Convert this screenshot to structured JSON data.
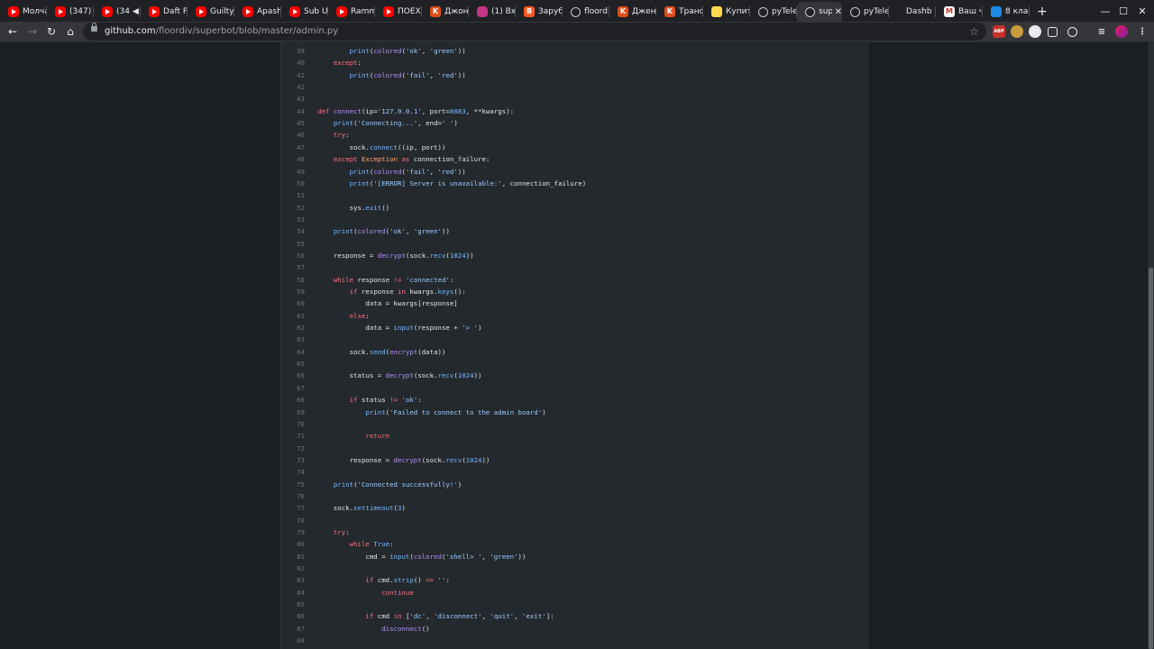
{
  "browser": {
    "tabs": [
      {
        "label": "Молча",
        "icon": "youtube-icon"
      },
      {
        "label": "(347) Y",
        "icon": "youtube-icon"
      },
      {
        "label": "(34 ◀",
        "icon": "youtube-icon"
      },
      {
        "label": "Daft P",
        "icon": "youtube-icon"
      },
      {
        "label": "Guilty",
        "icon": "youtube-icon"
      },
      {
        "label": "Apash",
        "icon": "youtube-icon"
      },
      {
        "label": "Sub U",
        "icon": "youtube-icon"
      },
      {
        "label": "Ramm",
        "icon": "youtube-icon"
      },
      {
        "label": "ПОЕХ",
        "icon": "youtube-icon"
      },
      {
        "label": "Джон",
        "icon": "kinopoisk-icon"
      },
      {
        "label": "(1) Вх",
        "icon": "instagram-icon"
      },
      {
        "label": "Заруб",
        "icon": "blogger-icon"
      },
      {
        "label": "floord",
        "icon": "github-icon"
      },
      {
        "label": "Джен",
        "icon": "kinopoisk-icon"
      },
      {
        "label": "Транс",
        "icon": "kinopoisk-icon"
      },
      {
        "label": "Купит",
        "icon": "yandex-market-icon"
      },
      {
        "label": "pyTele",
        "icon": "github-icon"
      },
      {
        "label": "sup",
        "icon": "github-icon",
        "active": true
      },
      {
        "label": "pyTele",
        "icon": "github-icon"
      },
      {
        "label": "Dashb",
        "icon": "blank-icon"
      },
      {
        "label": "Ваш ч",
        "icon": "gmail-icon"
      },
      {
        "label": "8 клас",
        "icon": "school-icon"
      }
    ],
    "url_host": "github.com",
    "url_path": "/floordiv/superbot/blob/master/admin.py",
    "new_tab": "+",
    "close_tab": "✕",
    "window_minimize": "—",
    "window_maximize": "☐",
    "window_close": "✕",
    "ext_abp": "ABP"
  },
  "code": {
    "lines": [
      {
        "n": "39",
        "t": [
          [
            "        ",
            ""
          ],
          [
            "print",
            "bi"
          ],
          [
            "(",
            ""
          ],
          [
            "colored",
            "fn"
          ],
          [
            "(",
            ""
          ],
          [
            "'ok'",
            "st"
          ],
          [
            ", ",
            ""
          ],
          [
            "'green'",
            "st"
          ],
          [
            "))",
            ""
          ]
        ]
      },
      {
        "n": "40",
        "t": [
          [
            "    ",
            ""
          ],
          [
            "except",
            "kw"
          ],
          [
            ":",
            ""
          ]
        ]
      },
      {
        "n": "41",
        "t": [
          [
            "        ",
            ""
          ],
          [
            "print",
            "bi"
          ],
          [
            "(",
            ""
          ],
          [
            "colored",
            "fn"
          ],
          [
            "(",
            ""
          ],
          [
            "'fail'",
            "st"
          ],
          [
            ", ",
            ""
          ],
          [
            "'red'",
            "st"
          ],
          [
            "))",
            ""
          ]
        ]
      },
      {
        "n": "42",
        "t": []
      },
      {
        "n": "43",
        "t": []
      },
      {
        "n": "44",
        "t": [
          [
            "def ",
            "kw"
          ],
          [
            "connect",
            "fn"
          ],
          [
            "(ip=",
            ""
          ],
          [
            "'127.0.0.1'",
            "st"
          ],
          [
            ", port=",
            ""
          ],
          [
            "8083",
            "nu"
          ],
          [
            ", **kwargs):",
            ""
          ]
        ]
      },
      {
        "n": "45",
        "t": [
          [
            "    ",
            ""
          ],
          [
            "print",
            "bi"
          ],
          [
            "(",
            ""
          ],
          [
            "'Connecting...'",
            "st"
          ],
          [
            ", end=",
            ""
          ],
          [
            "' '",
            "st"
          ],
          [
            ")",
            ""
          ]
        ]
      },
      {
        "n": "46",
        "t": [
          [
            "    ",
            ""
          ],
          [
            "try",
            "kw"
          ],
          [
            ":",
            ""
          ]
        ]
      },
      {
        "n": "47",
        "t": [
          [
            "        sock.",
            ""
          ],
          [
            "connect",
            "bi"
          ],
          [
            "((ip, port))",
            ""
          ]
        ]
      },
      {
        "n": "48",
        "t": [
          [
            "    ",
            ""
          ],
          [
            "except ",
            "kw"
          ],
          [
            "Exception",
            "ex"
          ],
          [
            " as ",
            "kw"
          ],
          [
            "connection_failure:",
            ""
          ]
        ]
      },
      {
        "n": "49",
        "t": [
          [
            "        ",
            ""
          ],
          [
            "print",
            "bi"
          ],
          [
            "(",
            ""
          ],
          [
            "colored",
            "fn"
          ],
          [
            "(",
            ""
          ],
          [
            "'fail'",
            "st"
          ],
          [
            ", ",
            ""
          ],
          [
            "'red'",
            "st"
          ],
          [
            "))",
            ""
          ]
        ]
      },
      {
        "n": "50",
        "t": [
          [
            "        ",
            ""
          ],
          [
            "print",
            "bi"
          ],
          [
            "(",
            ""
          ],
          [
            "'[ERROR] Server is unavailable:'",
            "st"
          ],
          [
            ", connection_failure)",
            ""
          ]
        ]
      },
      {
        "n": "51",
        "t": []
      },
      {
        "n": "52",
        "t": [
          [
            "        sys.",
            ""
          ],
          [
            "exit",
            "bi"
          ],
          [
            "()",
            ""
          ]
        ]
      },
      {
        "n": "53",
        "t": []
      },
      {
        "n": "54",
        "t": [
          [
            "    ",
            ""
          ],
          [
            "print",
            "bi"
          ],
          [
            "(",
            ""
          ],
          [
            "colored",
            "fn"
          ],
          [
            "(",
            ""
          ],
          [
            "'ok'",
            "st"
          ],
          [
            ", ",
            ""
          ],
          [
            "'green'",
            "st"
          ],
          [
            "))",
            ""
          ]
        ]
      },
      {
        "n": "55",
        "t": []
      },
      {
        "n": "56",
        "t": [
          [
            "    response = ",
            ""
          ],
          [
            "decrypt",
            "fn"
          ],
          [
            "(sock.",
            ""
          ],
          [
            "recv",
            "bi"
          ],
          [
            "(",
            ""
          ],
          [
            "1024",
            "nu"
          ],
          [
            "))",
            ""
          ]
        ]
      },
      {
        "n": "57",
        "t": []
      },
      {
        "n": "58",
        "t": [
          [
            "    ",
            ""
          ],
          [
            "while ",
            "kw"
          ],
          [
            "response ",
            ""
          ],
          [
            "!= ",
            "kw"
          ],
          [
            "'connected'",
            "st"
          ],
          [
            ":",
            ""
          ]
        ]
      },
      {
        "n": "59",
        "t": [
          [
            "        ",
            ""
          ],
          [
            "if ",
            "kw"
          ],
          [
            "response ",
            ""
          ],
          [
            "in ",
            "kw"
          ],
          [
            "kwargs.",
            ""
          ],
          [
            "keys",
            "bi"
          ],
          [
            "():",
            ""
          ]
        ]
      },
      {
        "n": "60",
        "t": [
          [
            "            data = kwargs[response]",
            ""
          ]
        ]
      },
      {
        "n": "61",
        "t": [
          [
            "        ",
            ""
          ],
          [
            "else",
            "kw"
          ],
          [
            ":",
            ""
          ]
        ]
      },
      {
        "n": "62",
        "t": [
          [
            "            data = ",
            ""
          ],
          [
            "input",
            "bi"
          ],
          [
            "(response + ",
            ""
          ],
          [
            "'> '",
            "st"
          ],
          [
            ")",
            ""
          ]
        ]
      },
      {
        "n": "63",
        "t": []
      },
      {
        "n": "64",
        "t": [
          [
            "        sock.",
            ""
          ],
          [
            "send",
            "bi"
          ],
          [
            "(",
            ""
          ],
          [
            "encrypt",
            "fn"
          ],
          [
            "(data))",
            ""
          ]
        ]
      },
      {
        "n": "65",
        "t": []
      },
      {
        "n": "66",
        "t": [
          [
            "        status = ",
            ""
          ],
          [
            "decrypt",
            "fn"
          ],
          [
            "(sock.",
            ""
          ],
          [
            "recv",
            "bi"
          ],
          [
            "(",
            ""
          ],
          [
            "1024",
            "nu"
          ],
          [
            "))",
            ""
          ]
        ]
      },
      {
        "n": "67",
        "t": []
      },
      {
        "n": "68",
        "t": [
          [
            "        ",
            ""
          ],
          [
            "if ",
            "kw"
          ],
          [
            "status ",
            ""
          ],
          [
            "!= ",
            "kw"
          ],
          [
            "'ok'",
            "st"
          ],
          [
            ":",
            ""
          ]
        ]
      },
      {
        "n": "69",
        "t": [
          [
            "            ",
            ""
          ],
          [
            "print",
            "bi"
          ],
          [
            "(",
            ""
          ],
          [
            "'Failed to connect to the admin board'",
            "st"
          ],
          [
            ")",
            ""
          ]
        ]
      },
      {
        "n": "70",
        "t": []
      },
      {
        "n": "71",
        "t": [
          [
            "            ",
            ""
          ],
          [
            "return",
            "kw"
          ]
        ]
      },
      {
        "n": "72",
        "t": []
      },
      {
        "n": "73",
        "t": [
          [
            "        response = ",
            ""
          ],
          [
            "decrypt",
            "fn"
          ],
          [
            "(sock.",
            ""
          ],
          [
            "recv",
            "bi"
          ],
          [
            "(",
            ""
          ],
          [
            "1024",
            "nu"
          ],
          [
            "))",
            ""
          ]
        ]
      },
      {
        "n": "74",
        "t": []
      },
      {
        "n": "75",
        "t": [
          [
            "    ",
            ""
          ],
          [
            "print",
            "bi"
          ],
          [
            "(",
            ""
          ],
          [
            "'Connected successfully!'",
            "st"
          ],
          [
            ")",
            ""
          ]
        ]
      },
      {
        "n": "76",
        "t": []
      },
      {
        "n": "77",
        "t": [
          [
            "    sock.",
            ""
          ],
          [
            "settimeout",
            "bi"
          ],
          [
            "(",
            ""
          ],
          [
            "3",
            "nu"
          ],
          [
            ")",
            ""
          ]
        ]
      },
      {
        "n": "78",
        "t": []
      },
      {
        "n": "79",
        "t": [
          [
            "    ",
            ""
          ],
          [
            "try",
            "kw"
          ],
          [
            ":",
            ""
          ]
        ]
      },
      {
        "n": "80",
        "t": [
          [
            "        ",
            ""
          ],
          [
            "while ",
            "kw"
          ],
          [
            "True",
            "nu"
          ],
          [
            ":",
            ""
          ]
        ]
      },
      {
        "n": "81",
        "t": [
          [
            "            cmd = ",
            ""
          ],
          [
            "input",
            "bi"
          ],
          [
            "(",
            ""
          ],
          [
            "colored",
            "fn"
          ],
          [
            "(",
            ""
          ],
          [
            "'shell> '",
            "st"
          ],
          [
            ", ",
            ""
          ],
          [
            "'green'",
            "st"
          ],
          [
            "))",
            ""
          ]
        ]
      },
      {
        "n": "82",
        "t": []
      },
      {
        "n": "83",
        "t": [
          [
            "            ",
            ""
          ],
          [
            "if ",
            "kw"
          ],
          [
            "cmd.",
            ""
          ],
          [
            "strip",
            "bi"
          ],
          [
            "() ",
            ""
          ],
          [
            "== ",
            "kw"
          ],
          [
            "''",
            "st"
          ],
          [
            ":",
            ""
          ]
        ]
      },
      {
        "n": "84",
        "t": [
          [
            "                ",
            ""
          ],
          [
            "continue",
            "kw"
          ]
        ]
      },
      {
        "n": "85",
        "t": []
      },
      {
        "n": "86",
        "t": [
          [
            "            ",
            ""
          ],
          [
            "if ",
            "kw"
          ],
          [
            "cmd ",
            ""
          ],
          [
            "in ",
            "kw"
          ],
          [
            "[",
            ""
          ],
          [
            "'dc'",
            "st"
          ],
          [
            ", ",
            ""
          ],
          [
            "'disconnect'",
            "st"
          ],
          [
            ", ",
            ""
          ],
          [
            "'quit'",
            "st"
          ],
          [
            ", ",
            ""
          ],
          [
            "'exit'",
            "st"
          ],
          [
            "]:",
            ""
          ]
        ]
      },
      {
        "n": "87",
        "t": [
          [
            "                ",
            ""
          ],
          [
            "disconnect",
            "fn"
          ],
          [
            "()",
            ""
          ]
        ]
      },
      {
        "n": "88",
        "t": []
      }
    ]
  },
  "colors": {
    "keyword": "#f97583",
    "function": "#b392f0",
    "builtin": "#79b8ff",
    "string": "#9ecbff",
    "exception": "#ffab70",
    "background": "#24292e"
  }
}
